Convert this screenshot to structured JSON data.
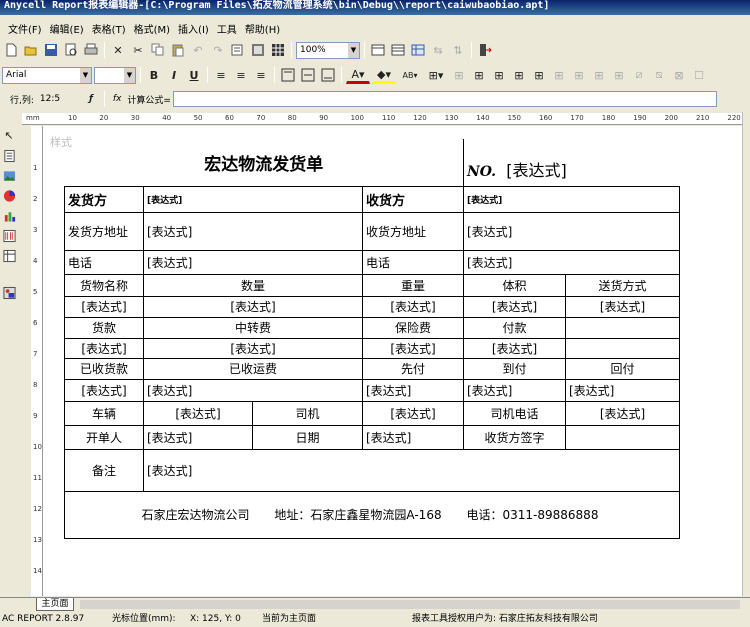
{
  "window": {
    "title": "Anycell Report报表编辑器-[C:\\Program Files\\拓友物流管理系统\\bin\\Debug\\\\report\\caiwubaobiao.apt]"
  },
  "menu": [
    {
      "label": "文件(F)"
    },
    {
      "label": "编辑(E)"
    },
    {
      "label": "表格(T)"
    },
    {
      "label": "格式(M)"
    },
    {
      "label": "插入(I)"
    },
    {
      "label": "工具"
    },
    {
      "label": "帮助(H)"
    }
  ],
  "toolbar": {
    "zoom": "100%",
    "font_name": "Arial",
    "font_size": "",
    "bold_label": "B",
    "italic_label": "I",
    "underline_label": "U"
  },
  "formula_bar": {
    "cell_label": "行,列:",
    "cell_ref": "12:5",
    "fx_label": "fx",
    "formula_label": "计算公式="
  },
  "ruler": {
    "unit": "mm",
    "ticks": [
      "10",
      "20",
      "30",
      "40",
      "50",
      "60",
      "70",
      "80",
      "90",
      "100",
      "110",
      "120",
      "130",
      "140",
      "150",
      "160",
      "170",
      "180",
      "190",
      "200",
      "210",
      "220"
    ],
    "vticks": [
      "1",
      "2",
      "3",
      "4",
      "5",
      "6",
      "7",
      "8",
      "9",
      "10",
      "11",
      "12",
      "13",
      "14"
    ]
  },
  "report": {
    "watermark": "样式",
    "title": "宏达物流发货单",
    "no_label": "NO.",
    "no_value": "[表达式]",
    "expr": "[表达式]",
    "sender": "发货方",
    "receiver": "收货方",
    "sender_addr": "发货方地址",
    "receiver_addr": "收货方地址",
    "phone": "电话",
    "goods_name": "货物名称",
    "quantity": "数量",
    "weight": "重量",
    "volume": "体积",
    "delivery_method": "送货方式",
    "payment": "货款",
    "transfer": "中转费",
    "insurance": "保险费",
    "paid": "付款",
    "received_payment": "已收货款",
    "received_freight": "已收运费",
    "prepaid": "先付",
    "on_arrival": "到付",
    "return_pay": "回付",
    "vehicle": "车辆",
    "driver": "司机",
    "driver_phone": "司机电话",
    "issuer": "开单人",
    "date": "日期",
    "receiver_sign": "收货方签字",
    "remark": "备注",
    "footer_company": "石家庄宏达物流公司",
    "footer_address": "地址：石家庄鑫星物流园A-168",
    "footer_phone": "电话：0311-89886888"
  },
  "tabs": [
    {
      "label": "主页面"
    }
  ],
  "status": {
    "version": "AC REPORT 2.8.97",
    "cursor_label": "光标位置(mm):",
    "cursor_value": "X: 125, Y: 0",
    "page": "当前为主页面",
    "license": "报表工具授权用户为: 石家庄拓友科技有限公司"
  }
}
